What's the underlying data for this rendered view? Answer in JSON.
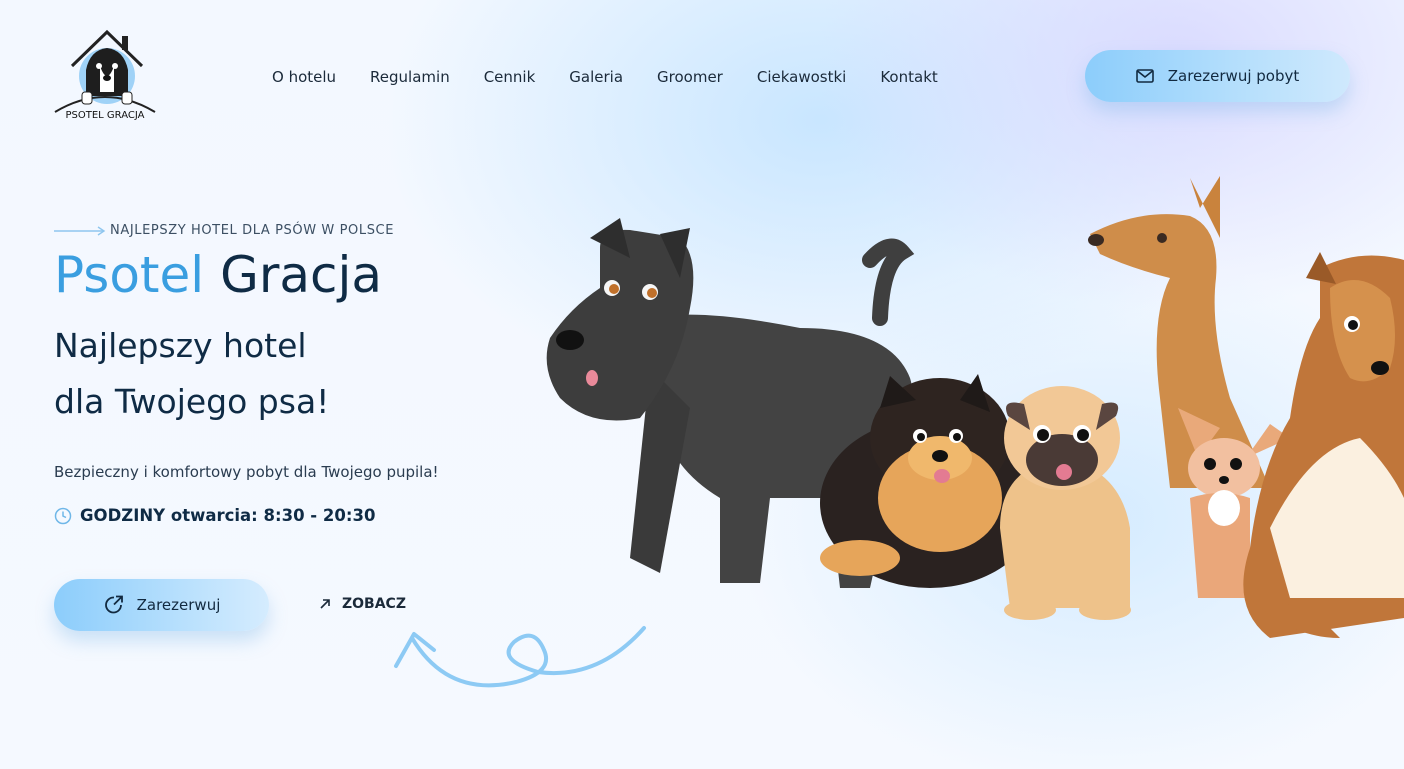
{
  "header": {
    "logo_text": "PSOTEL GRACJA",
    "nav": [
      {
        "label": "O hotelu"
      },
      {
        "label": "Regulamin"
      },
      {
        "label": "Cennik"
      },
      {
        "label": "Galeria"
      },
      {
        "label": "Groomer"
      },
      {
        "label": "Ciekawostki"
      },
      {
        "label": "Kontakt"
      }
    ],
    "cta_label": "Zarezerwuj pobyt",
    "cta_icon": "mail-icon"
  },
  "hero": {
    "kicker": "NAJLEPSZY HOTEL DLA PSÓW W POLSCE",
    "title_part1": "Psotel",
    "title_part2": "Gracja",
    "subtitle_line1": "Najlepszy hotel",
    "subtitle_line2": "dla Twojego psa!",
    "description": "Bezpieczny i komfortowy pobyt dla Twojego pupila!",
    "hours_icon": "clock-icon",
    "hours": "GODZINY otwarcia: 8:30 - 20:30",
    "reserve_label": "Zarezerwuj",
    "reserve_icon": "external-link-icon",
    "see_label": "ZOBACZ",
    "see_icon": "arrow-up-right-icon"
  },
  "colors": {
    "accent": "#3a9ee0",
    "dark": "#0f2b45",
    "button_gradient_start": "#8ccdfb",
    "button_gradient_end": "#d5ecfe"
  }
}
